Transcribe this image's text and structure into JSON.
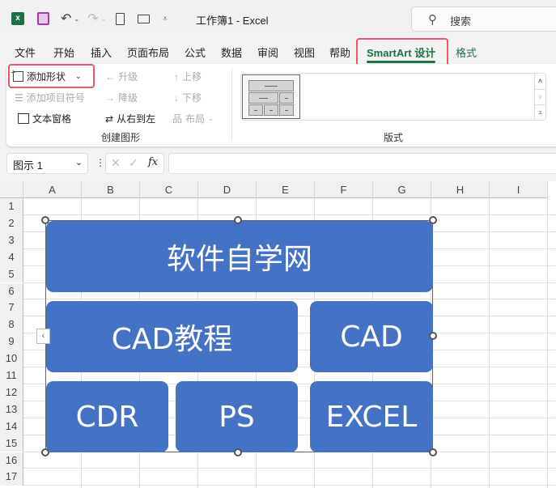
{
  "titlebar": {
    "title": "工作簿1 - Excel",
    "search_placeholder": "搜索",
    "icons": [
      "excel-logo-icon",
      "save-icon",
      "undo-icon",
      "redo-icon",
      "new-file-icon",
      "open-folder-icon",
      "customize-qat-icon"
    ]
  },
  "tabs": [
    {
      "label": "文件"
    },
    {
      "label": "开始"
    },
    {
      "label": "插入"
    },
    {
      "label": "页面布局"
    },
    {
      "label": "公式"
    },
    {
      "label": "数据"
    },
    {
      "label": "审阅"
    },
    {
      "label": "视图"
    },
    {
      "label": "帮助"
    },
    {
      "label": "SmartArt 设计",
      "active": true
    },
    {
      "label": "格式"
    }
  ],
  "ribbon": {
    "create_graphic": {
      "label": "创建图形",
      "add_shape": "添加形状",
      "add_bullet": "添加项目符号",
      "text_pane": "文本窗格",
      "promote": "升级",
      "demote": "降级",
      "right_to_left": "从右到左",
      "move_up": "上移",
      "move_down": "下移",
      "layout": "布局"
    },
    "layouts": {
      "label": "版式"
    }
  },
  "formula_bar": {
    "name_box": "图示 1",
    "fx": "fx",
    "value": ""
  },
  "columns": [
    "A",
    "B",
    "C",
    "D",
    "E",
    "F",
    "G",
    "H",
    "I"
  ],
  "rows": [
    "1",
    "2",
    "3",
    "4",
    "5",
    "6",
    "7",
    "8",
    "9",
    "10",
    "11",
    "12",
    "13",
    "14",
    "15",
    "16",
    "17"
  ],
  "smartart": {
    "nodes": [
      "软件自学网",
      "CAD教程",
      "CAD",
      "CDR",
      "PS",
      "EXCEL"
    ],
    "fill_color": "#4472c4"
  },
  "highlight_color": "#ea5867"
}
